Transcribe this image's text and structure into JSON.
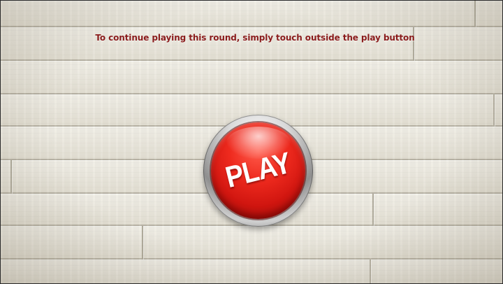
{
  "instruction_text": "To continue playing this round, simply touch outside the play button",
  "play_button": {
    "label": "PLAY"
  },
  "colors": {
    "instruction_text": "#8a1c1c",
    "button_red": "#e0231a",
    "button_rim": "#b8b8b8",
    "wall": "#ebe8de"
  },
  "icons": {
    "play_button": "red-dome-button"
  }
}
